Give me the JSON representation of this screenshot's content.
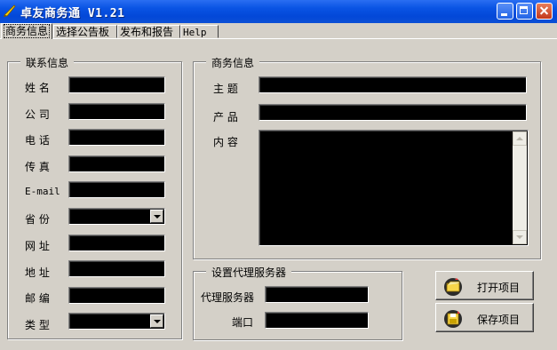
{
  "window": {
    "title": "卓友商务通 V1.21"
  },
  "tabs": [
    {
      "label": "商务信息"
    },
    {
      "label": "选择公告板"
    },
    {
      "label": "发布和报告"
    },
    {
      "label": "Help"
    }
  ],
  "contact": {
    "group_title": "联系信息",
    "fields": [
      {
        "label": "姓  名",
        "value": ""
      },
      {
        "label": "公  司",
        "value": ""
      },
      {
        "label": "电  话",
        "value": ""
      },
      {
        "label": "传  真",
        "value": ""
      },
      {
        "label": "E-mail",
        "value": ""
      },
      {
        "label": "省  份",
        "value": ""
      },
      {
        "label": "网  址",
        "value": ""
      },
      {
        "label": "地  址",
        "value": ""
      },
      {
        "label": "邮  编",
        "value": ""
      },
      {
        "label": "类  型",
        "value": ""
      }
    ]
  },
  "business": {
    "group_title": "商务信息",
    "subject_label": "主  题",
    "product_label": "产  品",
    "content_label": "内  容"
  },
  "proxy": {
    "group_title": "设置代理服务器",
    "server_label": "代理服务器",
    "port_label": "端口"
  },
  "actions": {
    "open_label": "打开项目",
    "save_label": "保存项目"
  }
}
